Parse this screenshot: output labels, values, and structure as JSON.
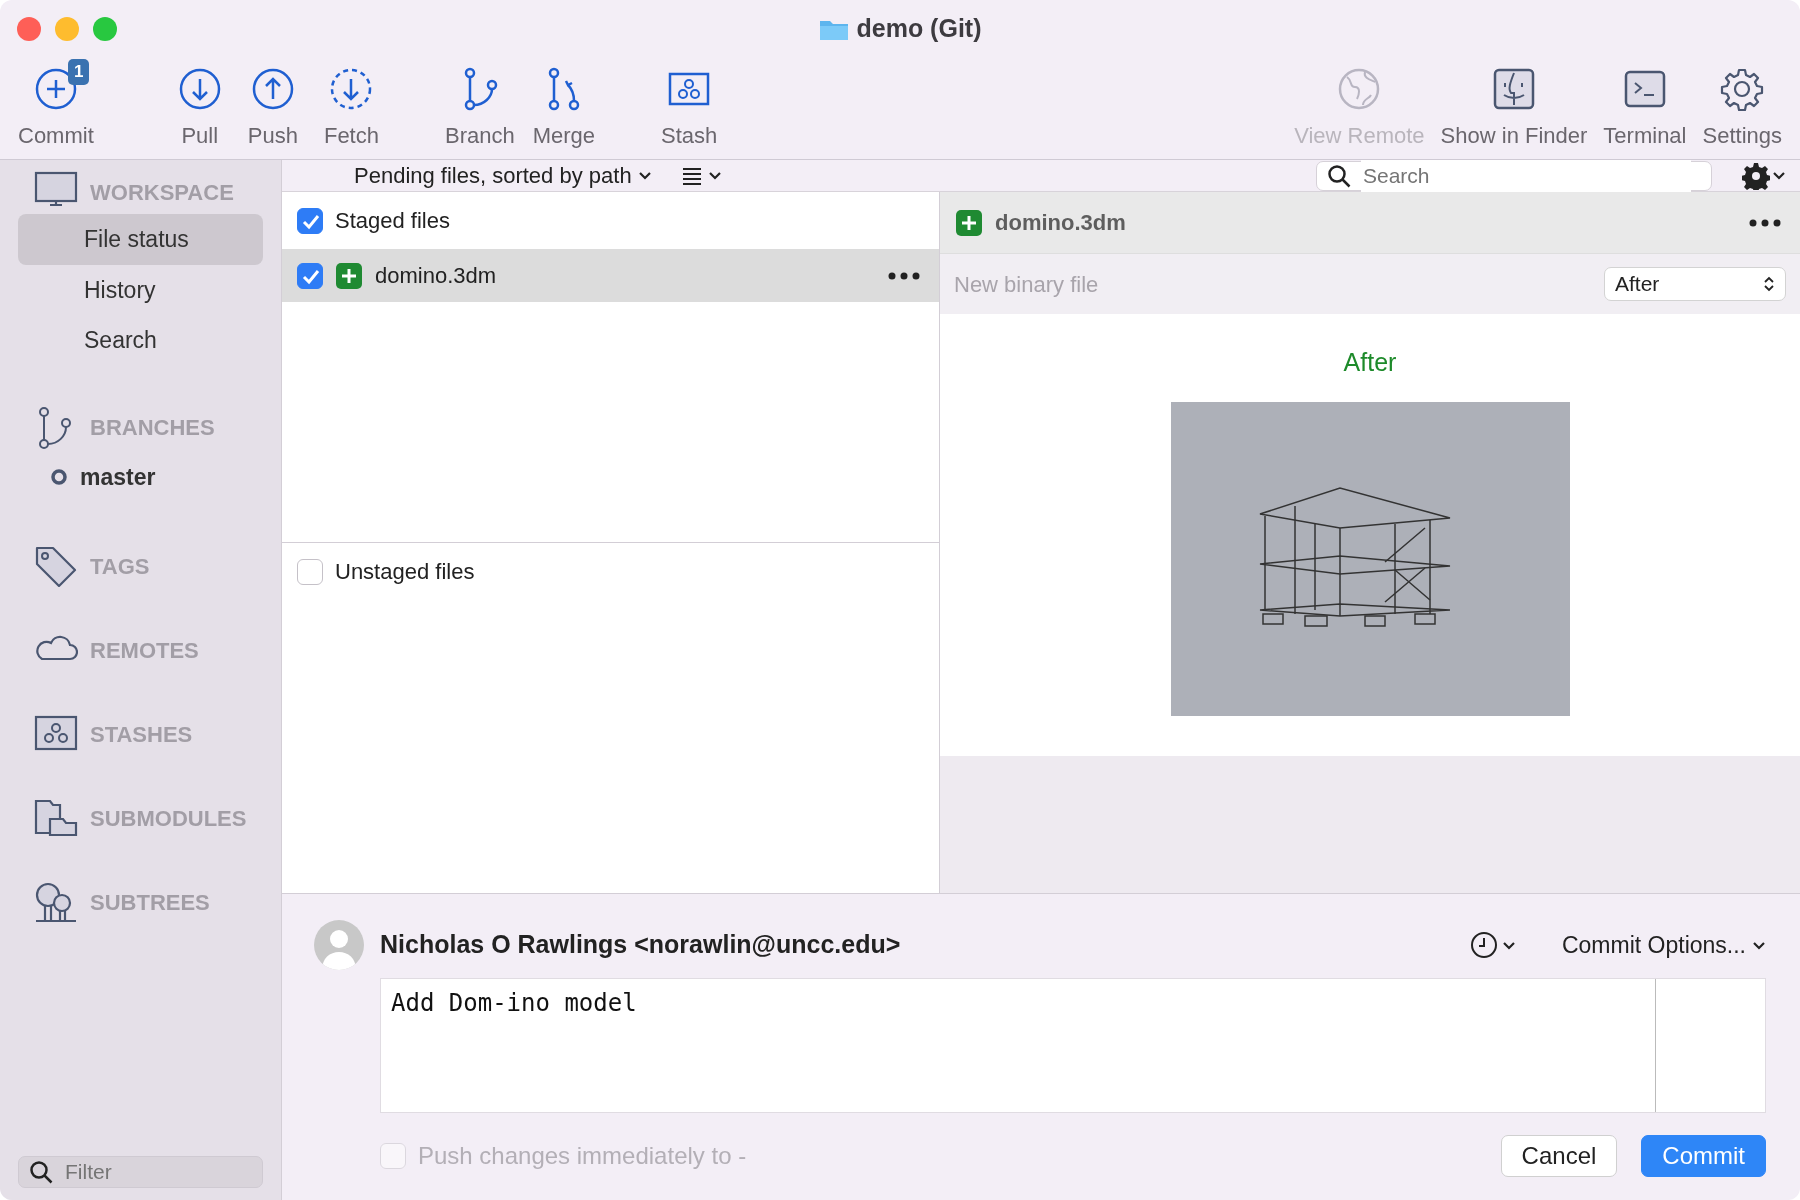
{
  "window": {
    "title": "demo (Git)"
  },
  "toolbar": {
    "left": [
      {
        "label": "Commit",
        "badge": "1",
        "disabled": false
      },
      {
        "label": "Pull",
        "disabled": false
      },
      {
        "label": "Push",
        "disabled": false
      },
      {
        "label": "Fetch",
        "disabled": false
      },
      {
        "label": "Branch",
        "disabled": false
      },
      {
        "label": "Merge",
        "disabled": false
      },
      {
        "label": "Stash",
        "disabled": false
      }
    ],
    "right": [
      {
        "label": "View Remote",
        "disabled": true
      },
      {
        "label": "Show in Finder",
        "disabled": false
      },
      {
        "label": "Terminal",
        "disabled": false
      },
      {
        "label": "Settings",
        "disabled": false
      }
    ]
  },
  "sidebar": {
    "sections": [
      {
        "title": "WORKSPACE",
        "items": [
          {
            "label": "File status",
            "selected": true
          },
          {
            "label": "History",
            "selected": false
          },
          {
            "label": "Search",
            "selected": false
          }
        ]
      },
      {
        "title": "BRANCHES",
        "items": [
          {
            "label": "master",
            "current": true
          }
        ]
      },
      {
        "title": "TAGS"
      },
      {
        "title": "REMOTES"
      },
      {
        "title": "STASHES"
      },
      {
        "title": "SUBMODULES"
      },
      {
        "title": "SUBTREES"
      }
    ],
    "filter": {
      "placeholder": "Filter"
    }
  },
  "subheader": {
    "sort_menu": "Pending files, sorted by path",
    "search": {
      "placeholder": "Search"
    }
  },
  "staged": {
    "label": "Staged files",
    "checked": true,
    "files": [
      {
        "name": "domino.3dm",
        "checked": true,
        "selected": true,
        "kind": "added"
      }
    ]
  },
  "unstaged": {
    "label": "Unstaged files",
    "checked": false
  },
  "diff": {
    "file_name": "domino.3dm",
    "kind": "added",
    "note": "New binary file",
    "view_select": "After",
    "preview_label": "After"
  },
  "commit": {
    "author": "Nicholas O Rawlings <norawlin@uncc.edu>",
    "options": "Commit Options...",
    "message": "Add Dom-ino model",
    "push": {
      "label": "Push changes immediately to -",
      "checked": false,
      "disabled": true
    },
    "buttons": [
      {
        "label": "Cancel",
        "kind": "secondary"
      },
      {
        "label": "Commit",
        "kind": "primary"
      }
    ]
  }
}
